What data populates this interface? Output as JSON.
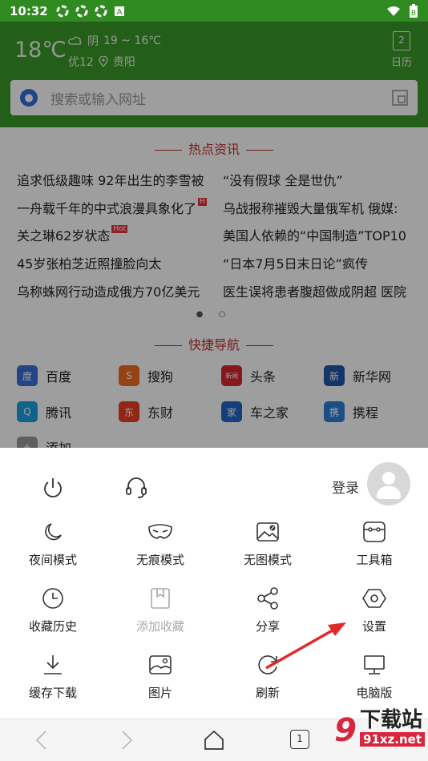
{
  "status_bar": {
    "time": "10:32",
    "battery_glyph": "B"
  },
  "weather": {
    "temp": "18℃",
    "condition": "阴",
    "range": "19 ~ 16℃",
    "air_quality": "优12",
    "city": "贵阳"
  },
  "calendar": {
    "day": "2",
    "label": "日历"
  },
  "search": {
    "placeholder": "搜索或输入网址"
  },
  "hot_news": {
    "title": "热点资讯",
    "left": [
      "追求低级趣味 92年出生的李雪被",
      "一舟载千年的中式浪漫具象化了",
      "关之琳62岁状态",
      "45岁张柏芝近照撞脸向太",
      "乌称蛛网行动造成俄方70亿美元"
    ],
    "right": [
      "“没有假球 全是世仇”",
      "乌战报称摧毁大量俄军机 俄媒:",
      "美国人依赖的“中国制造”TOP10",
      "“日本7月5日末日论”疯传",
      "医生误将患者腹超做成阴超 医院"
    ],
    "hot_badge": "Hot",
    "hot_badge_short": "H"
  },
  "quick_nav": {
    "title": "快捷导航",
    "items": [
      {
        "label": "百度",
        "icon": "baidu-icon",
        "color": "#3b6fd8",
        "glyph": "度"
      },
      {
        "label": "搜狗",
        "icon": "sogou-icon",
        "color": "#f36b21",
        "glyph": "S"
      },
      {
        "label": "头条",
        "icon": "toutiao-icon",
        "color": "#d8272f",
        "glyph": "新闻"
      },
      {
        "label": "新华网",
        "icon": "xinhua-icon",
        "color": "#2056a8",
        "glyph": "新"
      },
      {
        "label": "腾讯",
        "icon": "tencent-icon",
        "color": "#1aa0e0",
        "glyph": "Q"
      },
      {
        "label": "东财",
        "icon": "dongcai-icon",
        "color": "#ea3c24",
        "glyph": "东"
      },
      {
        "label": "车之家",
        "icon": "autohome-icon",
        "color": "#2563c8",
        "glyph": "家"
      },
      {
        "label": "携程",
        "icon": "ctrip-icon",
        "color": "#2d7fd6",
        "glyph": "携"
      }
    ],
    "add_label": "添加"
  },
  "menu": {
    "login": "登录",
    "items": [
      {
        "label": "夜间模式",
        "icon": "moon-icon",
        "enabled": true
      },
      {
        "label": "无痕模式",
        "icon": "mask-icon",
        "enabled": true
      },
      {
        "label": "无图模式",
        "icon": "no-image-icon",
        "enabled": true
      },
      {
        "label": "工具箱",
        "icon": "toolbox-icon",
        "enabled": true
      },
      {
        "label": "收藏历史",
        "icon": "clock-icon",
        "enabled": true
      },
      {
        "label": "添加收藏",
        "icon": "bookmark-icon",
        "enabled": false
      },
      {
        "label": "分享",
        "icon": "share-icon",
        "enabled": true
      },
      {
        "label": "设置",
        "icon": "settings-hexagon-icon",
        "enabled": true
      },
      {
        "label": "缓存下载",
        "icon": "download-icon",
        "enabled": true
      },
      {
        "label": "图片",
        "icon": "image-icon",
        "enabled": true
      },
      {
        "label": "刷新",
        "icon": "refresh-icon",
        "enabled": true
      },
      {
        "label": "电脑版",
        "icon": "desktop-icon",
        "enabled": true
      }
    ]
  },
  "bottom_nav": {
    "tab_count": "1"
  },
  "watermark": {
    "number": "9",
    "text": "下载站",
    "url": "91xz.net"
  },
  "colors": {
    "header_green": "#3a9a2a",
    "status_green": "#2f8a1f",
    "accent_red": "#c62d2d",
    "arrow_red": "#e02a2a"
  }
}
